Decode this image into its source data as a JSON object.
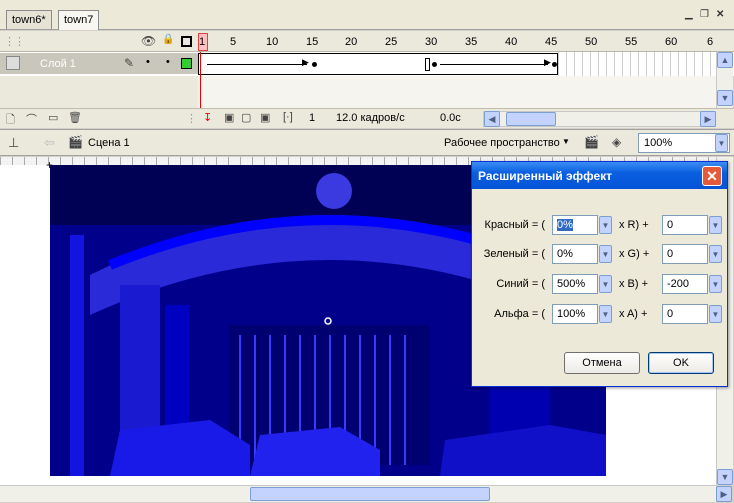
{
  "tabs": [
    {
      "label": "town6*"
    },
    {
      "label": "town7"
    }
  ],
  "timeline": {
    "header_icons": {
      "eye": "eye-icon",
      "lock": "lock-icon",
      "outline": "outline-icon"
    },
    "frame_numbers": [
      "1",
      "5",
      "10",
      "15",
      "20",
      "25",
      "30",
      "35",
      "40",
      "45",
      "50",
      "55",
      "60",
      "6"
    ],
    "layer": {
      "name": "Слой 1",
      "color": "#33cc33"
    },
    "current_frame": "1",
    "frame_rate": "12.0 кадров/с",
    "elapsed": "0.0c"
  },
  "scene": {
    "name": "Сцена 1",
    "workspace": "Рабочее пространство",
    "zoom": "100%"
  },
  "dialog": {
    "title": "Расширенный эффект",
    "rows": [
      {
        "label": "Красный = (",
        "percent": "0%",
        "op": "x R) +",
        "offset": "0"
      },
      {
        "label": "Зеленый = (",
        "percent": "0%",
        "op": "x G) +",
        "offset": "0"
      },
      {
        "label": "Синий = (",
        "percent": "500%",
        "op": "x B) +",
        "offset": "-200"
      },
      {
        "label": "Альфа = (",
        "percent": "100%",
        "op": "x A) +",
        "offset": "0"
      }
    ],
    "cancel": "Отмена",
    "ok": "OK"
  }
}
